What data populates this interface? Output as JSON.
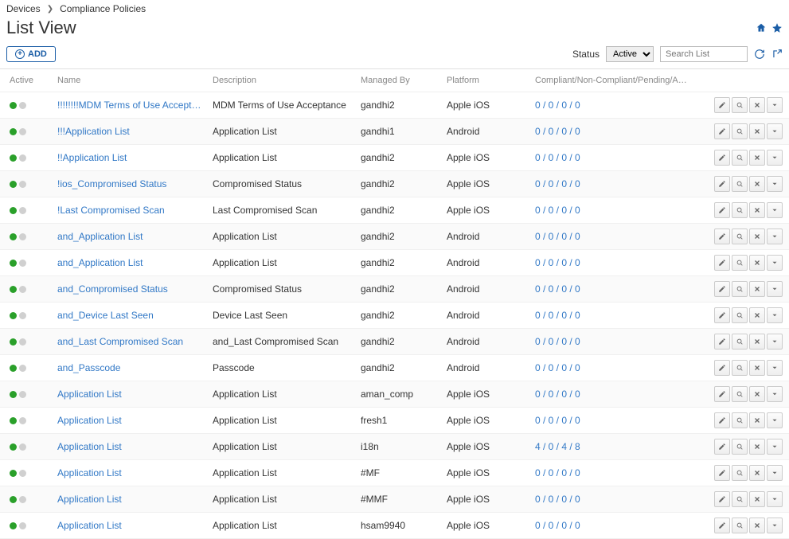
{
  "breadcrumb": {
    "root": "Devices",
    "current": "Compliance Policies"
  },
  "page_title": "List View",
  "toolbar": {
    "add_label": "ADD",
    "status_label": "Status",
    "status_value": "Active",
    "search_placeholder": "Search List"
  },
  "columns": {
    "active": "Active",
    "name": "Name",
    "description": "Description",
    "managed_by": "Managed By",
    "platform": "Platform",
    "compliance": "Compliant/Non-Compliant/Pending/Assigned"
  },
  "rows": [
    {
      "name": "!!!!!!!!MDM Terms of Use Acceptance",
      "description": "MDM Terms of Use Acceptance",
      "managed_by": "gandhi2",
      "platform": "Apple iOS",
      "compliance": "0 / 0 / 0 / 0"
    },
    {
      "name": "!!!Application List",
      "description": "Application List",
      "managed_by": "gandhi1",
      "platform": "Android",
      "compliance": "0 / 0 / 0 / 0"
    },
    {
      "name": "!!Application List",
      "description": "Application List",
      "managed_by": "gandhi2",
      "platform": "Apple iOS",
      "compliance": "0 / 0 / 0 / 0"
    },
    {
      "name": "!ios_Compromised Status",
      "description": "Compromised Status",
      "managed_by": "gandhi2",
      "platform": "Apple iOS",
      "compliance": "0 / 0 / 0 / 0"
    },
    {
      "name": "!Last Compromised Scan",
      "description": "Last Compromised Scan",
      "managed_by": "gandhi2",
      "platform": "Apple iOS",
      "compliance": "0 / 0 / 0 / 0"
    },
    {
      "name": "and_Application List",
      "description": "Application List",
      "managed_by": "gandhi2",
      "platform": "Android",
      "compliance": "0 / 0 / 0 / 0"
    },
    {
      "name": "and_Application List",
      "description": "Application List",
      "managed_by": "gandhi2",
      "platform": "Android",
      "compliance": "0 / 0 / 0 / 0"
    },
    {
      "name": "and_Compromised Status",
      "description": "Compromised Status",
      "managed_by": "gandhi2",
      "platform": "Android",
      "compliance": "0 / 0 / 0 / 0"
    },
    {
      "name": "and_Device Last Seen",
      "description": "Device Last Seen",
      "managed_by": "gandhi2",
      "platform": "Android",
      "compliance": "0 / 0 / 0 / 0"
    },
    {
      "name": "and_Last Compromised Scan",
      "description": "and_Last Compromised Scan",
      "managed_by": "gandhi2",
      "platform": "Android",
      "compliance": "0 / 0 / 0 / 0"
    },
    {
      "name": "and_Passcode",
      "description": "Passcode",
      "managed_by": "gandhi2",
      "platform": "Android",
      "compliance": "0 / 0 / 0 / 0"
    },
    {
      "name": "Application List",
      "description": "Application List",
      "managed_by": "aman_comp",
      "platform": "Apple iOS",
      "compliance": "0 / 0 / 0 / 0"
    },
    {
      "name": "Application List",
      "description": "Application List",
      "managed_by": "fresh1",
      "platform": "Apple iOS",
      "compliance": "0 / 0 / 0 / 0"
    },
    {
      "name": "Application List",
      "description": "Application List",
      "managed_by": "i18n",
      "platform": "Apple iOS",
      "compliance": "4 / 0 / 4 / 8"
    },
    {
      "name": "Application List",
      "description": "Application List",
      "managed_by": "#MF",
      "platform": "Apple iOS",
      "compliance": "0 / 0 / 0 / 0"
    },
    {
      "name": "Application List",
      "description": "Application List",
      "managed_by": "#MMF",
      "platform": "Apple iOS",
      "compliance": "0 / 0 / 0 / 0"
    },
    {
      "name": "Application List",
      "description": "Application List",
      "managed_by": "hsam9940",
      "platform": "Apple iOS",
      "compliance": "0 / 0 / 0 / 0"
    }
  ]
}
